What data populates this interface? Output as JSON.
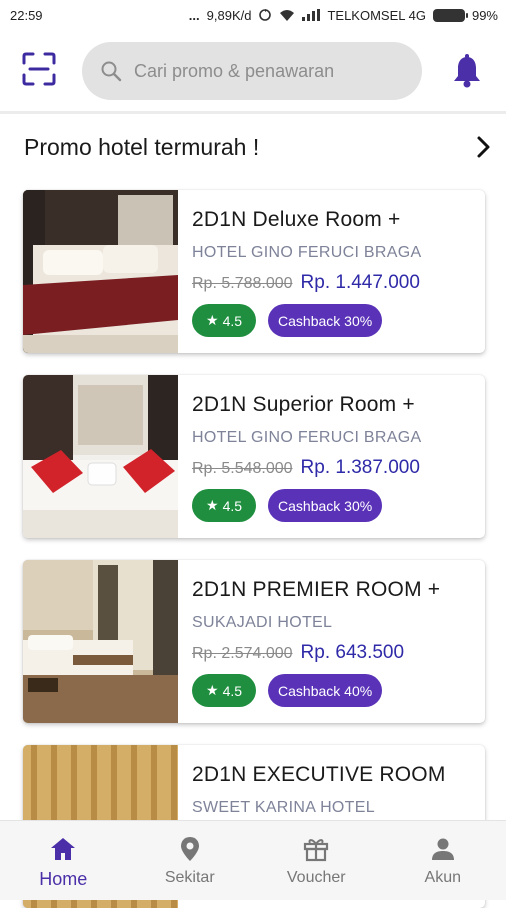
{
  "status_bar": {
    "time": "22:59",
    "dots": "...",
    "speed": "9,89K/d",
    "carrier": "TELKOMSEL 4G",
    "battery": "99%"
  },
  "header": {
    "search_placeholder": "Cari promo & penawaran"
  },
  "section": {
    "title": "Promo hotel termurah !"
  },
  "cards": [
    {
      "title": "2D1N Deluxe Room +",
      "hotel": "HOTEL GINO FERUCI BRAGA",
      "old_price": "Rp. 5.788.000",
      "new_price": "Rp. 1.447.000",
      "rating": "4.5",
      "cashback": "Cashback 30%"
    },
    {
      "title": "2D1N Superior Room +",
      "hotel": "HOTEL GINO FERUCI BRAGA",
      "old_price": "Rp. 5.548.000",
      "new_price": "Rp. 1.387.000",
      "rating": "4.5",
      "cashback": "Cashback 30%"
    },
    {
      "title": "2D1N PREMIER ROOM +",
      "hotel": "SUKAJADI HOTEL",
      "old_price": "Rp. 2.574.000",
      "new_price": "Rp. 643.500",
      "rating": "4.5",
      "cashback": "Cashback 40%"
    },
    {
      "title": "2D1N EXECUTIVE ROOM",
      "hotel": "SWEET KARINA HOTEL"
    }
  ],
  "bottom_nav": {
    "home": "Home",
    "nearby": "Sekitar",
    "voucher": "Voucher",
    "account": "Akun"
  },
  "colors": {
    "accent": "#4a2fa8",
    "price": "#2f2aa8",
    "rating_badge": "#1f8f3f",
    "cashback_badge": "#5a32b8"
  }
}
